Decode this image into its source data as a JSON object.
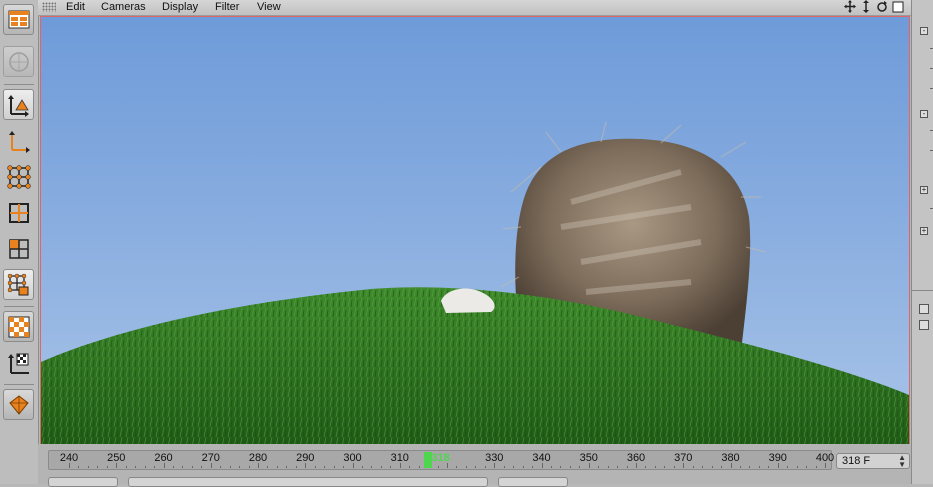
{
  "menu": {
    "items": [
      "Edit",
      "Cameras",
      "Display",
      "Filter",
      "View"
    ]
  },
  "nav_icons": [
    "move-view-icon",
    "zoom-view-icon",
    "rotate-view-icon",
    "toggle-view-icon"
  ],
  "toolbar": {
    "tools": [
      "layout-icon",
      "render-region-icon",
      "model-mode-icon",
      "object-axis-icon",
      "points-mode-icon",
      "edges-mode-icon",
      "polygons-mode-icon",
      "uvw-mode-icon",
      "texture-mode-icon",
      "texture-axis-icon",
      "sculpt-icon"
    ]
  },
  "timeline": {
    "ticks": [
      "240",
      "250",
      "260",
      "270",
      "280",
      "290",
      "300",
      "310",
      "320",
      "330",
      "340",
      "350",
      "360",
      "370",
      "380",
      "390",
      "400"
    ],
    "current_frame_label": "318",
    "current_frame_field": "318 F"
  },
  "colors": {
    "accent_orange": "#e8821e",
    "playhead_green": "#4fd64f",
    "sky_top": "#6e9bd9",
    "grass": "#2f7a22",
    "viewport_border": "#dd6666"
  }
}
